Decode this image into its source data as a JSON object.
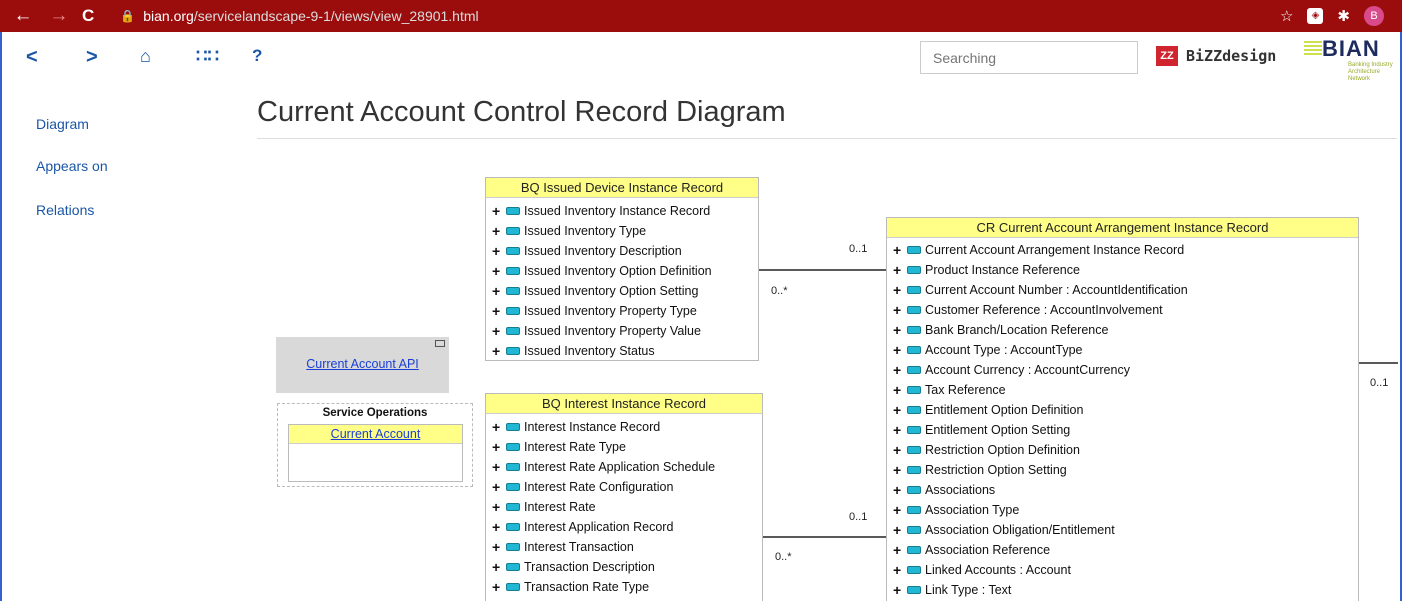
{
  "browser": {
    "url_domain": "bian.org",
    "url_path": "/servicelandscape-9-1/views/view_28901.html",
    "profile_initial": "B"
  },
  "toolbar": {
    "back": "<",
    "forward": ">",
    "help": "?",
    "search_placeholder": "Searching",
    "bizzdesign_mark": "ZZ",
    "bizzdesign_label": "BiZZdesign",
    "bian_label": "BIAN",
    "bian_sub1": "Banking Industry",
    "bian_sub2": "Architecture Network"
  },
  "sidebar": {
    "items": [
      {
        "label": "Diagram"
      },
      {
        "label": "Appears on"
      },
      {
        "label": "Relations"
      }
    ]
  },
  "page": {
    "title": "Current Account Control Record Diagram"
  },
  "diagram": {
    "issued_device": {
      "title": "BQ Issued Device Instance Record",
      "rows": [
        "Issued Inventory Instance Record",
        "Issued Inventory Type",
        "Issued Inventory Description",
        "Issued Inventory Option Definition",
        "Issued Inventory Option Setting",
        "Issued Inventory Property Type",
        "Issued Inventory Property Value",
        "Issued Inventory Status"
      ]
    },
    "interest": {
      "title": "BQ Interest Instance Record",
      "rows": [
        "Interest Instance Record",
        "Interest Rate Type",
        "Interest Rate Application Schedule",
        "Interest Rate Configuration",
        "Interest Rate",
        "Interest Application Record",
        "Interest Transaction",
        "Transaction Description",
        "Transaction Rate Type"
      ]
    },
    "current_account": {
      "title": "CR Current Account Arrangement Instance Record",
      "rows": [
        "Current Account Arrangement Instance Record",
        "Product Instance Reference",
        "Current Account Number : AccountIdentification",
        "Customer Reference : AccountInvolvement",
        "Bank Branch/Location Reference",
        "Account Type : AccountType",
        "Account Currency : AccountCurrency",
        "Tax Reference",
        "Entitlement Option Definition",
        "Entitlement Option Setting",
        "Restriction Option Definition",
        "Restriction Option Setting",
        "Associations",
        "Association Type",
        "Association Obligation/Entitlement",
        "Association Reference",
        "Linked Accounts : Account",
        "Link Type : Text"
      ]
    },
    "api": {
      "label": "Current Account API"
    },
    "service_operations": {
      "label": "Service Operations",
      "item": "Current Account"
    },
    "multiplicities": {
      "m1_target": "0..1",
      "m1_source": "0..*",
      "m2_target": "0..1",
      "m2_source": "0..*",
      "m3_target": "0..1"
    }
  }
}
